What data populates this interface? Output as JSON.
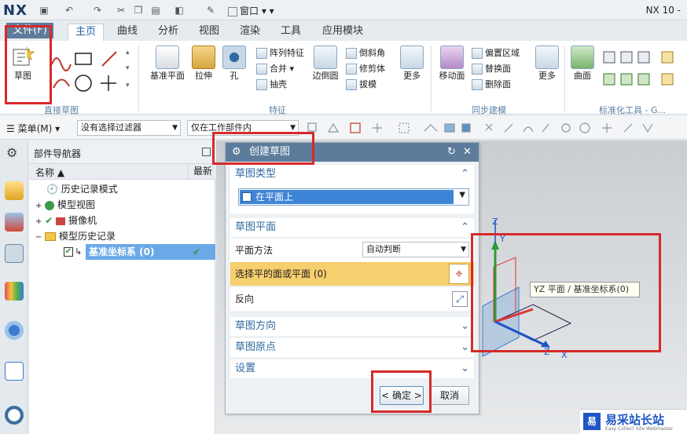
{
  "app": {
    "logo": "NX",
    "window_title": "NX 10 -",
    "window_menu": "窗口"
  },
  "tabs": [
    {
      "label": "文件(F)"
    },
    {
      "label": "主页"
    },
    {
      "label": "曲线"
    },
    {
      "label": "分析"
    },
    {
      "label": "视图"
    },
    {
      "label": "渲染"
    },
    {
      "label": "工具"
    },
    {
      "label": "应用模块"
    }
  ],
  "ribbon": {
    "sketch": "草图",
    "direct_sketch_group": "直接草图",
    "datum_plane": "基准平面",
    "extrude": "拉伸",
    "hole": "孔",
    "array_feature": "阵列特征",
    "unite": "合并",
    "shell": "抽壳",
    "edge_blend": "边倒圆",
    "chamfer": "倒斜角",
    "trim_body": "修剪体",
    "draft": "拔模",
    "more1": "更多",
    "feature_group": "特征",
    "move_face": "移动面",
    "offset_region": "偏置区域",
    "replace_face": "替换面",
    "delete_face": "删除面",
    "more2": "更多",
    "sync_group": "同步建模",
    "surface": "曲面",
    "std_tools_group": "标准化工具 - G..."
  },
  "filterbar": {
    "menu": "菜单(M)",
    "filter": "没有选择过滤器",
    "scope": "仅在工作部件内"
  },
  "navigator": {
    "title": "部件导航器",
    "col_name": "名称",
    "col_latest": "最新",
    "rows": [
      {
        "label": "历史记录模式"
      },
      {
        "label": "模型视图"
      },
      {
        "label": "摄像机"
      },
      {
        "label": "模型历史记录"
      },
      {
        "label": "基准坐标系 (0)"
      }
    ]
  },
  "dialog": {
    "title": "创建草图",
    "sec_type": "草图类型",
    "type_value": "在平面上",
    "sec_plane": "草图平面",
    "plane_method_label": "平面方法",
    "plane_method_value": "自动判断",
    "select_plane": "选择平的面或平面 (0)",
    "reverse": "反向",
    "sec_orient": "草图方向",
    "sec_origin": "草图原点",
    "sec_settings": "设置",
    "ok": "< 确定 >",
    "cancel": "取消"
  },
  "viewport": {
    "tooltip": "YZ 平面 / 基准坐标系(0)",
    "axis_z": "Z",
    "axis_y": "Y",
    "axis_x": "X"
  },
  "watermark": {
    "text": "易采站长站",
    "sub": "Easy Collect Site Webmaster"
  },
  "colors": {
    "accent": "#5d7c9c",
    "annotation_red": "#d62a2a",
    "highlight": "#f6cf6e",
    "select_blue": "#6aa8e8"
  }
}
